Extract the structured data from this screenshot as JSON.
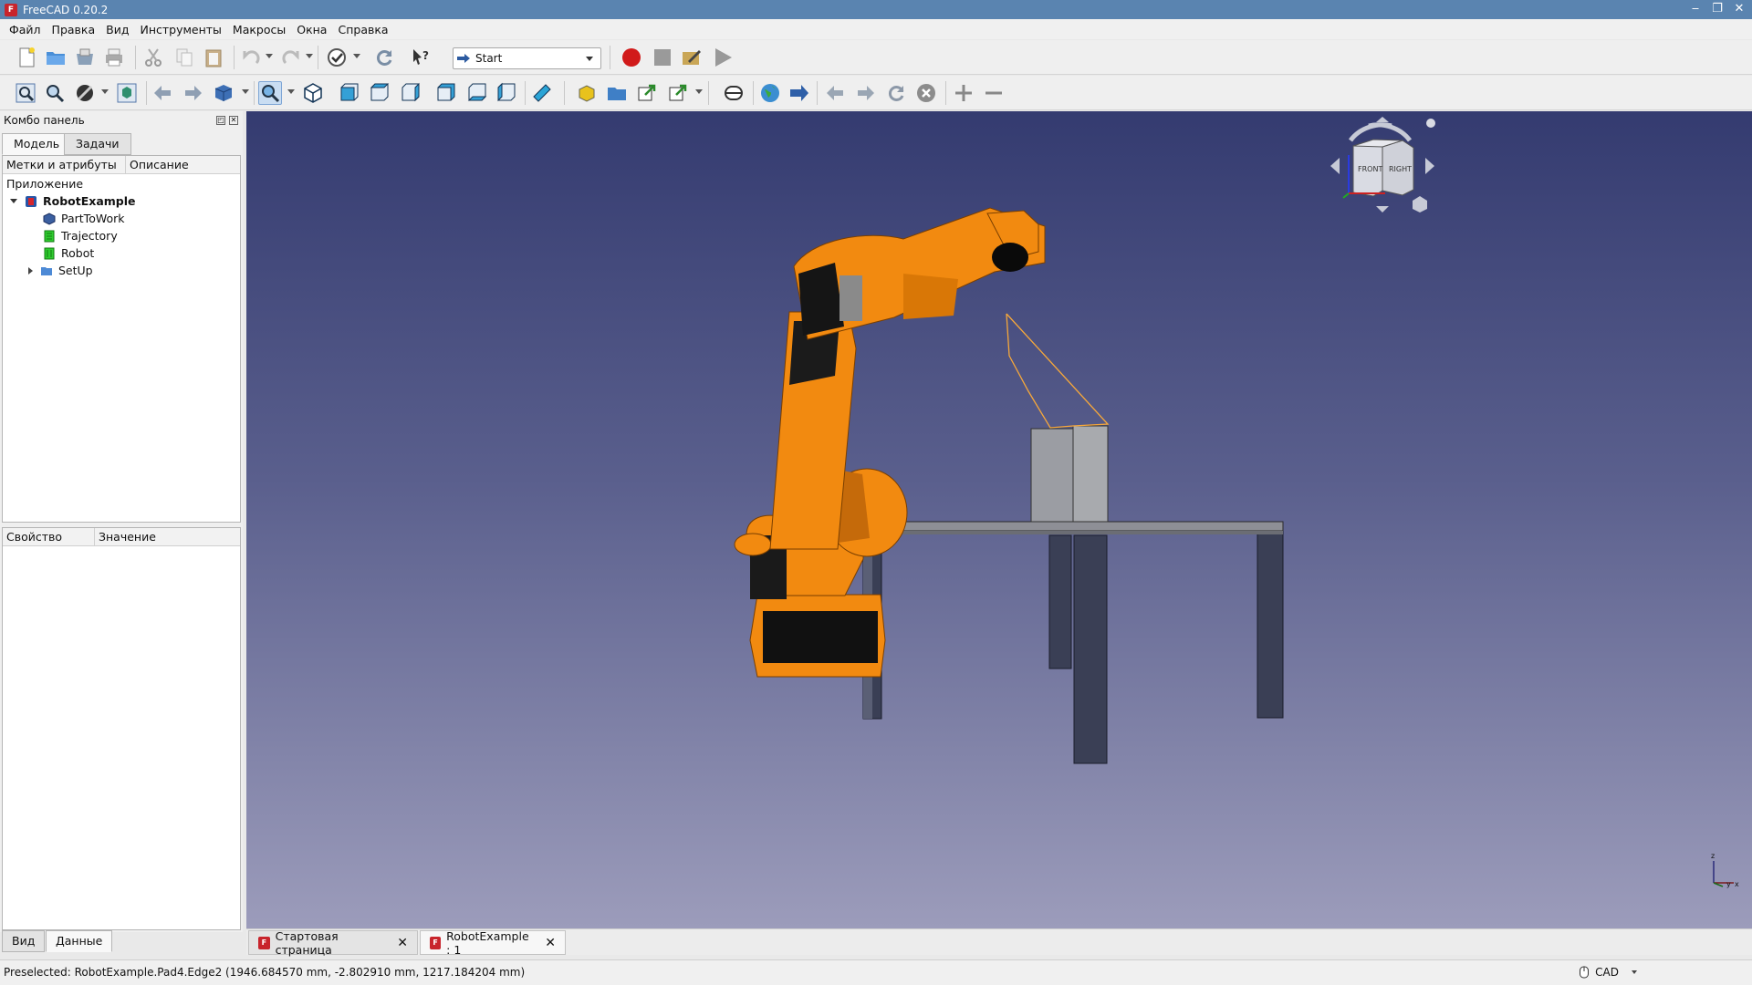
{
  "window": {
    "title": "FreeCAD 0.20.2",
    "min": "‒",
    "restore": "❐",
    "close": "✕"
  },
  "menu": [
    "Файл",
    "Правка",
    "Вид",
    "Инструменты",
    "Макросы",
    "Окна",
    "Справка"
  ],
  "toolbar": {
    "workbench": "Start"
  },
  "combo": {
    "title": "Комбо панель",
    "tabs": [
      "Модель",
      "Задачи"
    ],
    "tree_headers": [
      "Метки и атрибуты",
      "Описание"
    ],
    "tree_root": "Приложение",
    "tree": [
      {
        "label": "RobotExample",
        "icon": "document-icon"
      },
      {
        "label": "PartToWork",
        "icon": "part-icon"
      },
      {
        "label": "Trajectory",
        "icon": "trajectory-icon"
      },
      {
        "label": "Robot",
        "icon": "robot-icon"
      },
      {
        "label": "SetUp",
        "icon": "folder-icon"
      }
    ],
    "prop_headers": [
      "Свойство",
      "Значение"
    ],
    "view_tabs": [
      "Вид",
      "Данные"
    ]
  },
  "navcube": {
    "front": "FRONT",
    "right": "RIGHT"
  },
  "axis": {
    "z": "z",
    "y": "y",
    "x": "x"
  },
  "doc_tabs": [
    {
      "label": "Стартовая страница",
      "close": "✕"
    },
    {
      "label": "RobotExample : 1",
      "close": "✕"
    }
  ],
  "status": {
    "text": "Preselected: RobotExample.Pad4.Edge2 (1946.684570 mm, -2.802910 mm, 1217.184204 mm)",
    "nav_style": "CAD"
  },
  "colors": {
    "robot": "#f28a10",
    "title_bar": "#5a84b0",
    "viewport_top": "#343b70",
    "viewport_bottom": "#9c9cbb"
  }
}
